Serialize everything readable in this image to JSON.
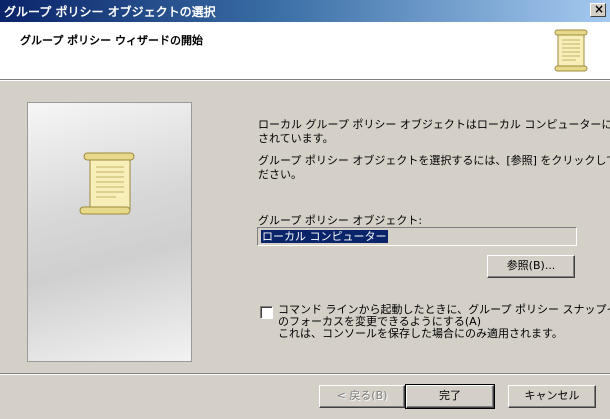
{
  "window": {
    "title": "グループ ポリシー オブジェクトの選択",
    "close_glyph": "×"
  },
  "header": {
    "heading": "グループ ポリシー ウィザードの開始"
  },
  "body": {
    "text1_line1": "ローカル グループ ポリシー オブジェクトはローカル コンピューターに格納",
    "text1_line2": "されています。",
    "text2_line1": "グループ ポリシー オブジェクトを選択するには、[参照] をクリックしてく",
    "text2_line2": "ださい。",
    "gpo_label": "グループ ポリシー オブジェクト:",
    "gpo_value": "ローカル コンピューター",
    "browse_label": "参照(B)...",
    "checkbox_line1": "コマンド ラインから起動したときに、グループ ポリシー スナップイン",
    "checkbox_line2": "のフォーカスを変更できるようにする(A)",
    "checkbox_line3": "これは、コンソールを保存した場合にのみ適用されます。",
    "checkbox_checked": false
  },
  "footer": {
    "back_label": "< 戻る(B)",
    "finish_label": "完了",
    "cancel_label": "キャンセル"
  },
  "icons": {
    "header_icon": "scroll-icon",
    "panel_icon": "scroll-icon"
  },
  "colors": {
    "titlebar_start": "#0a246a",
    "titlebar_end": "#a6caf0",
    "selection": "#0a246a",
    "face": "#d4d0c8"
  }
}
